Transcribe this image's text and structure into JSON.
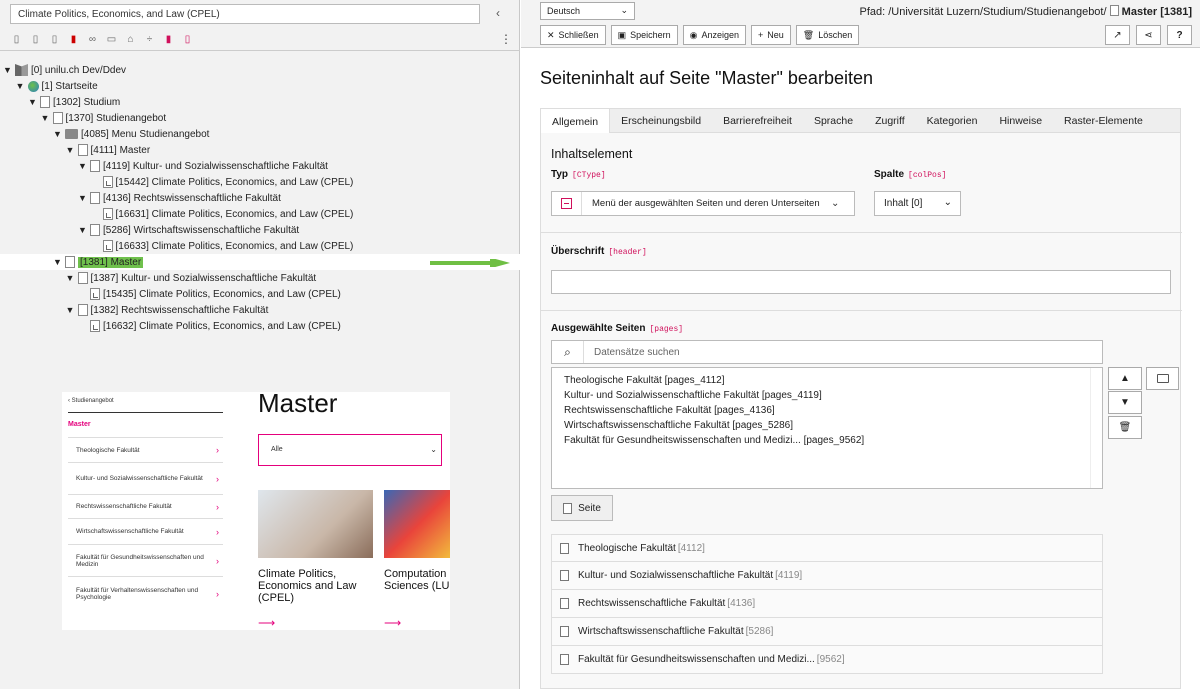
{
  "left": {
    "search_value": "Climate Politics, Economics, and Law (CPEL)",
    "collapse": "‹",
    "more": "⋮",
    "tree": [
      {
        "id": "n0",
        "indent": 0,
        "toggle": "▼",
        "icon": "root",
        "text": "[0] unilu.ch Dev/Ddev"
      },
      {
        "id": "n1",
        "indent": 1,
        "toggle": "▼",
        "icon": "globe",
        "text": "[1] Startseite"
      },
      {
        "id": "n2",
        "indent": 2,
        "toggle": "▼",
        "icon": "page",
        "text": "[1302] Studium"
      },
      {
        "id": "n3",
        "indent": 3,
        "toggle": "▼",
        "icon": "page",
        "text": "[1370] Studienangebot"
      },
      {
        "id": "n4",
        "indent": 4,
        "toggle": "▼",
        "icon": "folder",
        "text": "[4085] Menu Studienangebot"
      },
      {
        "id": "n5",
        "indent": 5,
        "toggle": "▼",
        "icon": "page",
        "text": "[4111] Master"
      },
      {
        "id": "n6",
        "indent": 6,
        "toggle": "▼",
        "icon": "page",
        "text": "[4119] Kultur- und Sozialwissenschaftliche Fakultät"
      },
      {
        "id": "n7",
        "indent": 7,
        "toggle": "",
        "icon": "link",
        "text": "[15442] Climate Politics, Economics, and Law (CPEL)"
      },
      {
        "id": "n8",
        "indent": 6,
        "toggle": "▼",
        "icon": "page",
        "text": "[4136] Rechtswissenschaftliche Fakultät"
      },
      {
        "id": "n9",
        "indent": 7,
        "toggle": "",
        "icon": "link",
        "text": "[16631] Climate Politics, Economics, and Law (CPEL)"
      },
      {
        "id": "n10",
        "indent": 6,
        "toggle": "▼",
        "icon": "page",
        "text": "[5286] Wirtschaftswissenschaftliche Fakultät"
      },
      {
        "id": "n11",
        "indent": 7,
        "toggle": "",
        "icon": "link",
        "text": "[16633] Climate Politics, Economics, and Law (CPEL)"
      },
      {
        "id": "n12",
        "indent": 4,
        "toggle": "▼",
        "icon": "page",
        "text": "[1381] Master",
        "highlight": true
      },
      {
        "id": "n13",
        "indent": 5,
        "toggle": "▼",
        "icon": "page",
        "text": "[1387] Kultur- und Sozialwissenschaftliche Fakultät"
      },
      {
        "id": "n14",
        "indent": 6,
        "toggle": "",
        "icon": "link",
        "text": "[15435] Climate Politics, Economics, and Law (CPEL)"
      },
      {
        "id": "n15",
        "indent": 5,
        "toggle": "▼",
        "icon": "page",
        "text": "[1382] Rechtswissenschaftliche Fakultät"
      },
      {
        "id": "n16",
        "indent": 6,
        "toggle": "",
        "icon": "link",
        "text": "[16632] Climate Politics, Economics, and Law (CPEL)"
      }
    ],
    "arrow_color": "#6fbf44"
  },
  "preview": {
    "back": "‹  Studienangebot",
    "section": "Master",
    "items": [
      "Theologische Fakultät",
      "Kultur- und Sozialwissenschaftliche Fakultät",
      "Rechtswissenschaftliche Fakultät",
      "Wirtschaftswissenschaftliche Fakultät",
      "Fakultät für Gesundheitswissenschaften und Medizin",
      "Fakultät für Verhaltenswissenschaften und Psychologie"
    ],
    "title": "Master",
    "filter": "Alle",
    "card1": "Climate Politics, Economics and Law (CPEL)",
    "card2": "Computation Sciences (LU",
    "accent": "#e4007c"
  },
  "right": {
    "language": "Deutsch",
    "path_label": "Pfad: /Universität Luzern/Studium/Studienangebot/",
    "path_current": "Master [1381]",
    "buttons": {
      "close": "Schließen",
      "save": "Speichern",
      "view": "Anzeigen",
      "new": "Neu",
      "delete": "Löschen"
    },
    "heading": "Seiteninhalt auf Seite \"Master\" bearbeiten",
    "tabs": [
      "Allgemein",
      "Erscheinungsbild",
      "Barrierefreiheit",
      "Sprache",
      "Zugriff",
      "Kategorien",
      "Hinweise",
      "Raster-Elemente"
    ],
    "panel_title": "Inhaltselement",
    "ctype_label": "Typ",
    "ctype_code": "[CType]",
    "ctype_value": "Menü der ausgewählten Seiten und deren Unterseiten",
    "colpos_label": "Spalte",
    "colpos_code": "[colPos]",
    "colpos_value": "Inhalt [0]",
    "header_label": "Überschrift",
    "header_code": "[header]",
    "header_value": "",
    "pages_label": "Ausgewählte Seiten",
    "pages_code": "[pages]",
    "search_placeholder": "Datensätze suchen",
    "selected": [
      "Theologische Fakultät [pages_4112]",
      "Kultur- und Sozialwissenschaftliche Fakultät [pages_4119]",
      "Rechtswissenschaftliche Fakultät [pages_4136]",
      "Wirtschaftswissenschaftliche Fakultät [pages_5286]",
      "Fakultät für Gesundheitswissenschaften und Medizi... [pages_9562]"
    ],
    "seite_button": "Seite",
    "records": [
      {
        "name": "Theologische Fakultät",
        "uid": "[4112]"
      },
      {
        "name": "Kultur- und Sozialwissenschaftliche Fakultät",
        "uid": "[4119]"
      },
      {
        "name": "Rechtswissenschaftliche Fakultät",
        "uid": "[4136]"
      },
      {
        "name": "Wirtschaftswissenschaftliche Fakultät",
        "uid": "[5286]"
      },
      {
        "name": "Fakultät für Gesundheitswissenschaften und Medizi...",
        "uid": "[9562]"
      }
    ]
  }
}
